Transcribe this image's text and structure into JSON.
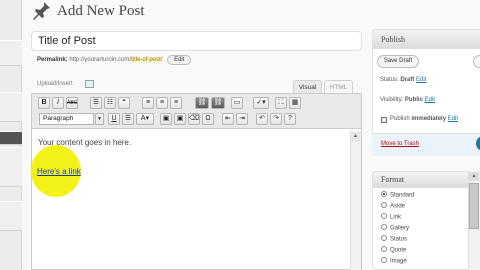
{
  "header": {
    "title": "Add New Post"
  },
  "post": {
    "title_value": "Title of Post",
    "permalink_label": "Permalink:",
    "permalink_base": "http://yourarturoin.com/",
    "permalink_slug": "title-of-post/",
    "permalink_edit": "Edit"
  },
  "editor": {
    "upload_insert_label": "Upload/Insert",
    "tabs": {
      "visual": "Visual",
      "html": "HTML"
    },
    "format_select": "Paragraph",
    "content_text": "Your content goes in here.",
    "link_text": "Here's a link",
    "highlight_color": "#f2f20e",
    "toolbar_row1": [
      "bold",
      "italic",
      "strikethrough",
      "bullet-list",
      "numbered-list",
      "blockquote",
      "align-left",
      "align-center",
      "align-right",
      "insert-link",
      "remove-link",
      "more",
      "spellcheck",
      "fullscreen",
      "kitchen-sink"
    ],
    "toolbar_row2": [
      "underline",
      "justify",
      "text-color",
      "paste-text",
      "paste-word",
      "clear-formatting",
      "special-char",
      "outdent",
      "indent",
      "undo",
      "redo",
      "help"
    ]
  },
  "publish": {
    "heading": "Publish",
    "save_draft": "Save Draft",
    "status_label": "Status:",
    "status_value": "Draft",
    "visibility_label": "Visibility:",
    "visibility_value": "Public",
    "publish_label": "Publish",
    "publish_value": "immediately",
    "edit_link": "Edit",
    "trash_link": "Move to Trash",
    "accent_color": "#21759b"
  },
  "format": {
    "heading": "Format",
    "options": [
      "Standard",
      "Aside",
      "Link",
      "Gallery",
      "Status",
      "Quote",
      "Image"
    ],
    "selected": "Standard"
  }
}
